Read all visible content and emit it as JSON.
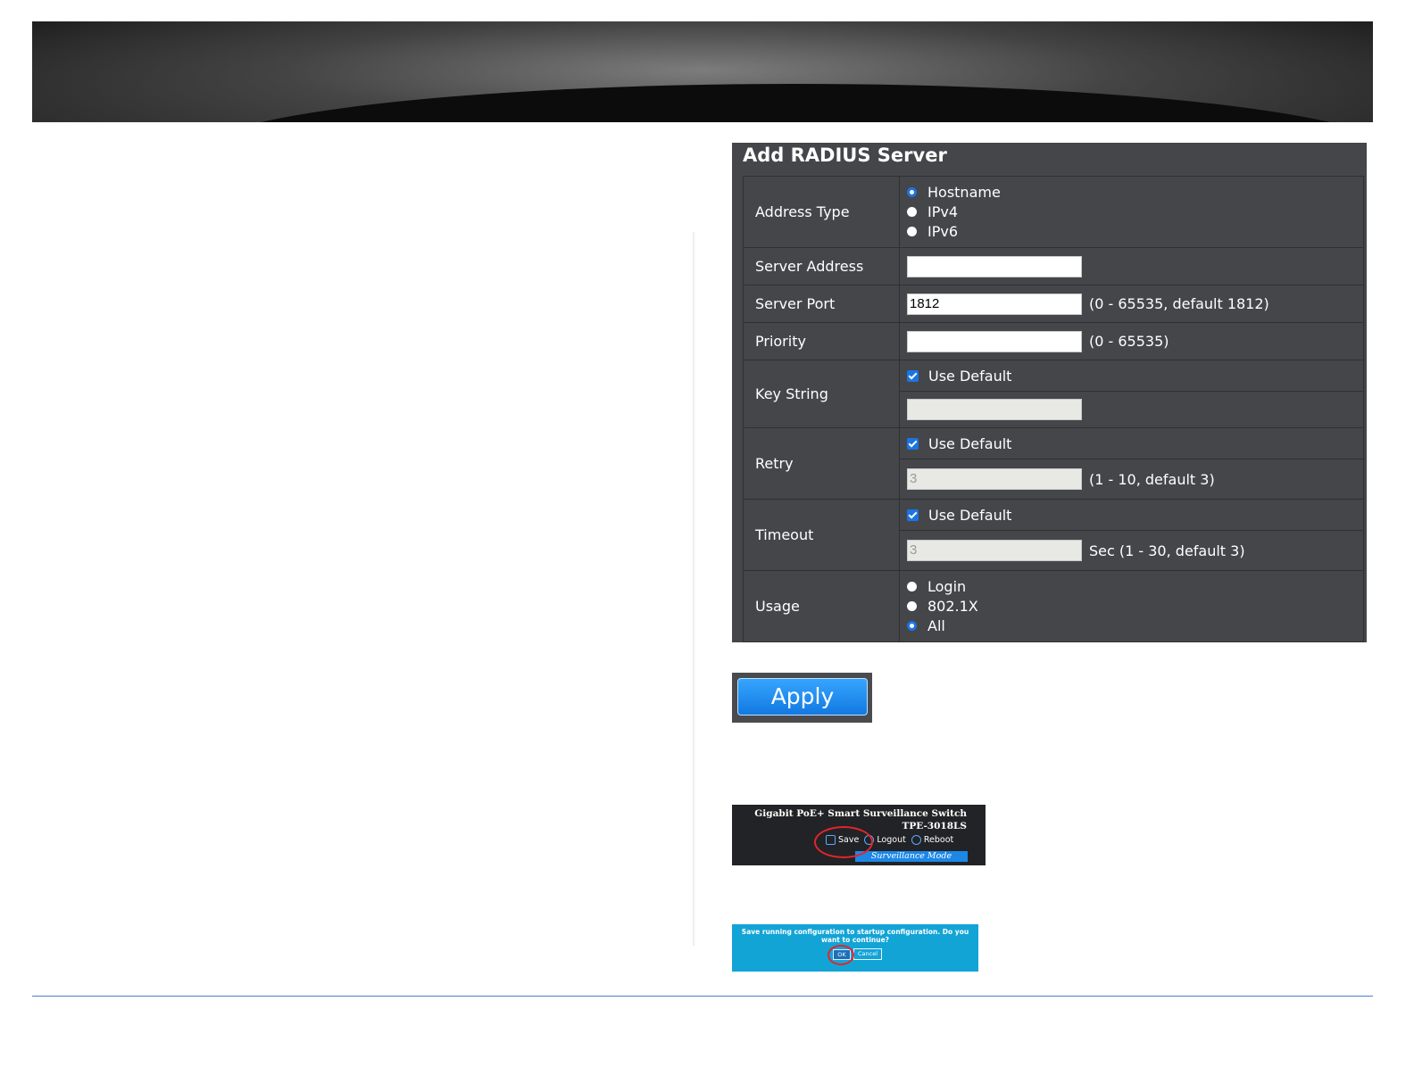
{
  "panel": {
    "title": "Add RADIUS Server",
    "address_type": {
      "label": "Address Type",
      "options": [
        "Hostname",
        "IPv4",
        "IPv6"
      ],
      "selected": "Hostname"
    },
    "server_address": {
      "label": "Server Address",
      "value": ""
    },
    "server_port": {
      "label": "Server Port",
      "value": "1812",
      "hint": "(0 - 65535, default 1812)"
    },
    "priority": {
      "label": "Priority",
      "value": "",
      "hint": "(0 - 65535)"
    },
    "key_string": {
      "label": "Key String",
      "use_default_label": "Use Default",
      "use_default": true,
      "value": ""
    },
    "retry": {
      "label": "Retry",
      "use_default_label": "Use Default",
      "use_default": true,
      "value": "3",
      "hint": "(1 - 10, default 3)"
    },
    "timeout": {
      "label": "Timeout",
      "use_default_label": "Use Default",
      "use_default": true,
      "value": "3",
      "hint": "Sec (1 - 30, default 3)"
    },
    "usage": {
      "label": "Usage",
      "options": [
        "Login",
        "802.1X",
        "All"
      ],
      "selected": "All"
    }
  },
  "apply_button": "Apply",
  "header": {
    "product": "Gigabit PoE+ Smart Surveillance Switch",
    "model": "TPE-3018LS",
    "save": "Save",
    "logout": "Logout",
    "reboot": "Reboot",
    "mode": "Surveillance Mode"
  },
  "confirm": {
    "message": "Save running configuration to startup configuration. Do you want to continue?",
    "ok": "OK",
    "cancel": "Cancel"
  },
  "colors": {
    "accent": "#1b74e4",
    "panel_bg": "#45464a",
    "dialog_bg": "#13a4d6",
    "highlight": "#e3242b"
  }
}
